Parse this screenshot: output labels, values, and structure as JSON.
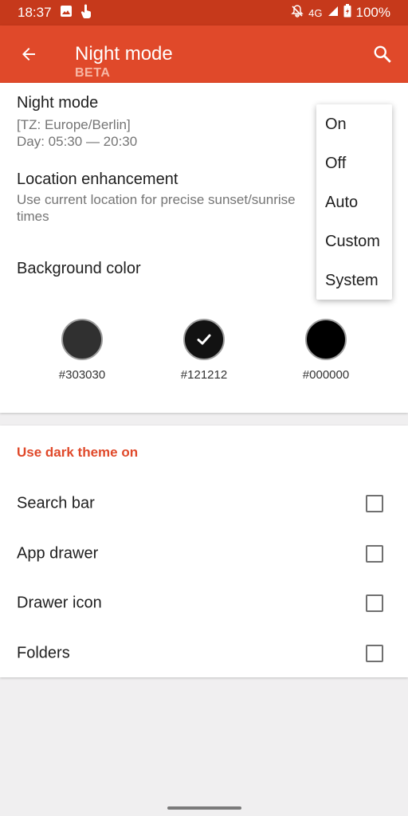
{
  "status_bar": {
    "time": "18:37",
    "network": "4G",
    "battery": "100%",
    "icons": [
      "image-icon",
      "touch-icon",
      "notifications-off-icon",
      "signal-icon",
      "battery-icon"
    ]
  },
  "app_bar": {
    "title": "Night mode",
    "subtitle": "BETA",
    "icons": [
      "back-arrow-icon",
      "search-icon"
    ]
  },
  "night_mode": {
    "title": "Night mode",
    "timezone": "[TZ: Europe/Berlin]",
    "day": "Day: 05:30 — 20:30"
  },
  "location": {
    "title": "Location enhancement",
    "summary": "Use current location for precise sunset/sunrise times"
  },
  "background": {
    "title": "Background color",
    "swatches": [
      {
        "label": "#303030",
        "color": "#303030",
        "selected": false
      },
      {
        "label": "#121212",
        "color": "#121212",
        "selected": true
      },
      {
        "label": "#000000",
        "color": "#000000",
        "selected": false
      }
    ]
  },
  "dark_theme": {
    "header": "Use dark theme on",
    "items": [
      {
        "label": "Search bar",
        "checked": false
      },
      {
        "label": "App drawer",
        "checked": false
      },
      {
        "label": "Drawer icon",
        "checked": false
      },
      {
        "label": "Folders",
        "checked": false
      }
    ]
  },
  "dropdown": {
    "options": [
      "On",
      "Off",
      "Auto",
      "Custom",
      "System"
    ]
  },
  "colors": {
    "accent": "#e0492a",
    "status_bar": "#c6391b"
  }
}
